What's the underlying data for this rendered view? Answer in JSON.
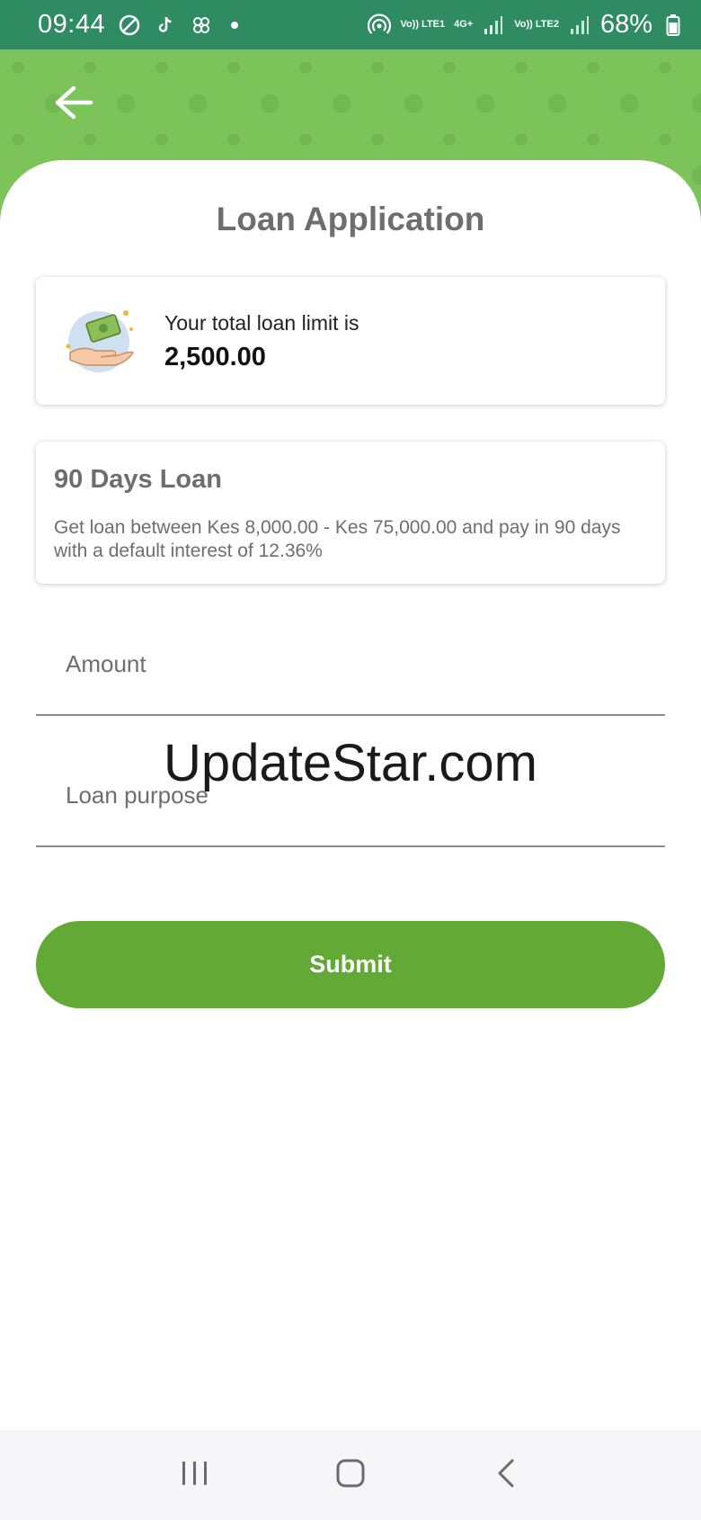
{
  "status_bar": {
    "time": "09:44",
    "network1": "Vo)) LTE1",
    "network2_type": "4G+",
    "network3": "Vo)) LTE2",
    "battery": "68%",
    "icons": [
      "no-disturb-icon",
      "tiktok-icon",
      "pinwheel-icon",
      "notification-dot-icon",
      "hotspot-icon",
      "signal-icon",
      "battery-icon"
    ]
  },
  "header": {
    "back_icon": "arrow-left-icon",
    "background_color": "#7cc35a"
  },
  "page": {
    "title": "Loan Application"
  },
  "limit_card": {
    "label": "Your total loan limit is",
    "amount": "2,500.00",
    "illustration": "hand-holding-money-icon"
  },
  "product_card": {
    "title": "90 Days Loan",
    "description": "Get loan between Kes 8,000.00 - Kes 75,000.00 and pay in 90 days with a default interest of 12.36%"
  },
  "form": {
    "amount_label": "Amount",
    "purpose_label": "Loan purpose",
    "submit_label": "Submit"
  },
  "watermark": "UpdateStar.com",
  "colors": {
    "status_bar": "#2e8b62",
    "accent": "#62a936",
    "text_muted": "#6e6e6e"
  },
  "nav_bar": {
    "icons": [
      "recent-apps-icon",
      "home-icon",
      "back-icon"
    ]
  }
}
